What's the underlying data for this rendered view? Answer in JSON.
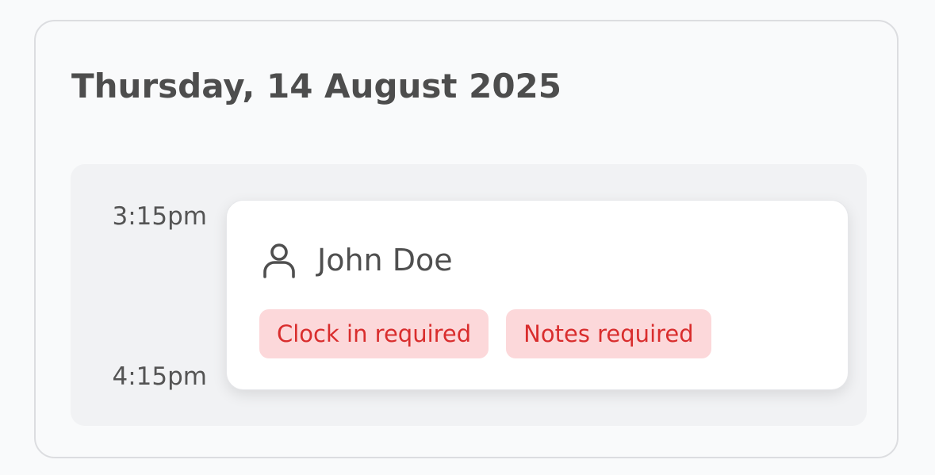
{
  "day": {
    "date_title": "Thursday, 14 August 2025"
  },
  "schedule": {
    "start_time": "3:15pm",
    "end_time": "4:15pm"
  },
  "shift": {
    "assignee_icon": "person-icon",
    "assignee_name": "John Doe",
    "badges": [
      {
        "label": "Clock in required",
        "color": "#d92d2d",
        "background": "#fcd8da"
      },
      {
        "label": "Notes required",
        "color": "#d92d2d",
        "background": "#fcd8da"
      }
    ]
  }
}
